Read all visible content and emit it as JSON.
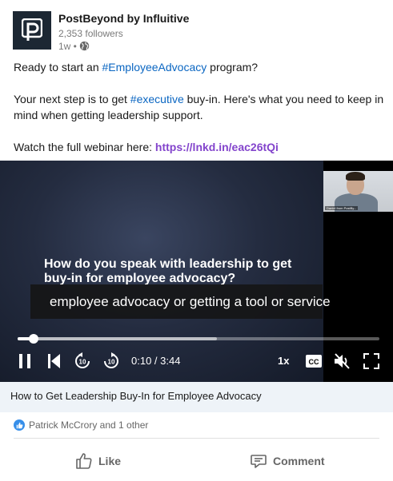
{
  "author": {
    "name": "PostBeyond by Influitive",
    "followers": "2,353 followers",
    "time": "1w •"
  },
  "post": {
    "line1_prefix": "Ready to start an ",
    "line1_tag": "#EmployeeAdvocacy",
    "line1_suffix": " program?",
    "line2_prefix": "Your next step is to get ",
    "line2_tag": "#executive",
    "line2_suffix": " buy-in. Here's what you need to keep in mind when getting leadership support.",
    "line3_prefix": "Watch the full webinar here: ",
    "line3_link": "https://lnkd.in/eac26tQi"
  },
  "video": {
    "slide_text": "How do you speak with leadership to get buy-in for employee advocacy?",
    "caption": "employee advocacy or getting a tool or service",
    "webcam_label": "Daniel from PostBy...",
    "time": "0:10 / 3:44",
    "speed": "1x",
    "cc": "CC",
    "progress_played": 0.045,
    "progress_buffered": 0.55,
    "title": "How to Get Leadership Buy-In for Employee Advocacy"
  },
  "social": {
    "reactions": "Patrick McCrory and 1 other"
  },
  "actions": {
    "like": "Like",
    "comment": "Comment"
  },
  "colors": {
    "link_blue": "#0a66c2",
    "url_purple": "#8344cc",
    "reaction_blue": "#378fe9"
  }
}
